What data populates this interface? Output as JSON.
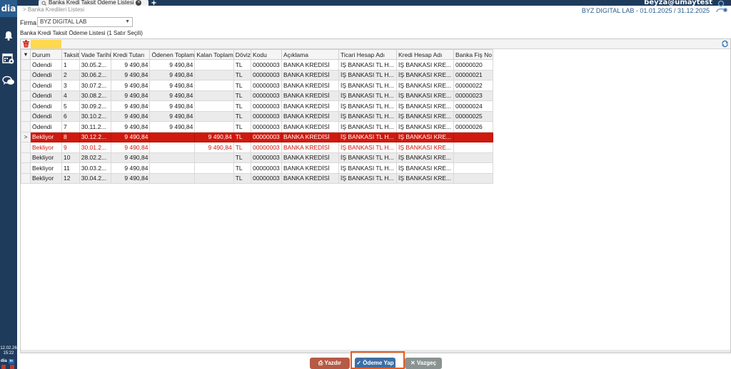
{
  "app": {
    "logo": "dia",
    "tab_title": "Banka Kredi Taksit Ödeme Listesi",
    "tab_close_icon": "close-icon",
    "tab_add": "+",
    "breadcrumb": "> Banka Kredileri Listesi",
    "user": "beyza@umaytest",
    "company_period": "BYZ DIGITAL LAB - 01.01.2025 / 31.12.2025"
  },
  "sidebar": {
    "icons": [
      "bell-icon",
      "calendar-gear-icon",
      "chat-icon"
    ],
    "date": "12.02.26",
    "time": "15:22",
    "brand": "dia",
    "social": "in"
  },
  "filter": {
    "firma_label": "Firma",
    "firma_value": "BYZ DIGITAL LAB"
  },
  "list": {
    "title": "Banka Kredi Taksit Ödeme Listesi  (1 Satır Seçili)"
  },
  "grid": {
    "columns": [
      "Durum",
      "Taksit",
      "Vade Tarihi",
      "Kredi Tutarı",
      "Ödenen Toplam",
      "Kalan Toplam",
      "Döviz",
      "Kodu",
      "Açıklama",
      "Ticari Hesap Adı",
      "Kredi Hesap Adı",
      "Banka Fiş No"
    ],
    "selected_indicator": ">",
    "rows": [
      {
        "durum": "Ödendi",
        "taksit": "1",
        "vade": "30.05.2...",
        "kredi": "9 490,84",
        "odenen": "9 490,84",
        "kalan": "",
        "doviz": "TL",
        "kodu": "00000003",
        "aciklama": "BANKA KREDİSİ",
        "ticari": "İŞ BANKASI TL H...",
        "kredi_hesap": "İŞ BANKASI KRE...",
        "fis": "00000020",
        "state": "paid"
      },
      {
        "durum": "Ödendi",
        "taksit": "2",
        "vade": "30.06.2...",
        "kredi": "9 490,84",
        "odenen": "9 490,84",
        "kalan": "",
        "doviz": "TL",
        "kodu": "00000003",
        "aciklama": "BANKA KREDİSİ",
        "ticari": "İŞ BANKASI TL H...",
        "kredi_hesap": "İŞ BANKASI KRE...",
        "fis": "00000021",
        "state": "paid"
      },
      {
        "durum": "Ödendi",
        "taksit": "3",
        "vade": "30.07.2...",
        "kredi": "9 490,84",
        "odenen": "9 490,84",
        "kalan": "",
        "doviz": "TL",
        "kodu": "00000003",
        "aciklama": "BANKA KREDİSİ",
        "ticari": "İŞ BANKASI TL H...",
        "kredi_hesap": "İŞ BANKASI KRE...",
        "fis": "00000022",
        "state": "paid"
      },
      {
        "durum": "Ödendi",
        "taksit": "4",
        "vade": "30.08.2...",
        "kredi": "9 490,84",
        "odenen": "9 490,84",
        "kalan": "",
        "doviz": "TL",
        "kodu": "00000003",
        "aciklama": "BANKA KREDİSİ",
        "ticari": "İŞ BANKASI TL H...",
        "kredi_hesap": "İŞ BANKASI KRE...",
        "fis": "00000023",
        "state": "paid"
      },
      {
        "durum": "Ödendi",
        "taksit": "5",
        "vade": "30.09.2...",
        "kredi": "9 490,84",
        "odenen": "9 490,84",
        "kalan": "",
        "doviz": "TL",
        "kodu": "00000003",
        "aciklama": "BANKA KREDİSİ",
        "ticari": "İŞ BANKASI TL H...",
        "kredi_hesap": "İŞ BANKASI KRE...",
        "fis": "00000024",
        "state": "paid"
      },
      {
        "durum": "Ödendi",
        "taksit": "6",
        "vade": "30.10.2...",
        "kredi": "9 490,84",
        "odenen": "9 490,84",
        "kalan": "",
        "doviz": "TL",
        "kodu": "00000003",
        "aciklama": "BANKA KREDİSİ",
        "ticari": "İŞ BANKASI TL H...",
        "kredi_hesap": "İŞ BANKASI KRE...",
        "fis": "00000025",
        "state": "paid"
      },
      {
        "durum": "Ödendi",
        "taksit": "7",
        "vade": "30.11.2...",
        "kredi": "9 490,84",
        "odenen": "9 490,84",
        "kalan": "",
        "doviz": "TL",
        "kodu": "00000003",
        "aciklama": "BANKA KREDİSİ",
        "ticari": "İŞ BANKASI TL H...",
        "kredi_hesap": "İŞ BANKASI KRE...",
        "fis": "00000026",
        "state": "paid"
      },
      {
        "durum": "Bekliyor",
        "taksit": "8",
        "vade": "30.12.2...",
        "kredi": "9 490,84",
        "odenen": "",
        "kalan": "9 490,84",
        "doviz": "TL",
        "kodu": "00000003",
        "aciklama": "BANKA KREDİSİ",
        "ticari": "İŞ BANKASI TL H...",
        "kredi_hesap": "İŞ BANKASI KRE...",
        "fis": "",
        "state": "selected"
      },
      {
        "durum": "Bekliyor",
        "taksit": "9",
        "vade": "30.01.2...",
        "kredi": "9 490,84",
        "odenen": "",
        "kalan": "9 490,84",
        "doviz": "TL",
        "kodu": "00000003",
        "aciklama": "BANKA KREDİSİ",
        "ticari": "İŞ BANKASI TL H...",
        "kredi_hesap": "İŞ BANKASI KRE...",
        "fis": "",
        "state": "pending-red"
      },
      {
        "durum": "Bekliyor",
        "taksit": "10",
        "vade": "28.02.2...",
        "kredi": "9 490,84",
        "odenen": "",
        "kalan": "",
        "doviz": "TL",
        "kodu": "00000003",
        "aciklama": "BANKA KREDİSİ",
        "ticari": "İŞ BANKASI TL H...",
        "kredi_hesap": "İŞ BANKASI KRE...",
        "fis": "",
        "state": "pending"
      },
      {
        "durum": "Bekliyor",
        "taksit": "11",
        "vade": "30.03.2...",
        "kredi": "9 490,84",
        "odenen": "",
        "kalan": "",
        "doviz": "TL",
        "kodu": "00000003",
        "aciklama": "BANKA KREDİSİ",
        "ticari": "İŞ BANKASI TL H...",
        "kredi_hesap": "İŞ BANKASI KRE...",
        "fis": "",
        "state": "pending"
      },
      {
        "durum": "Bekliyor",
        "taksit": "12",
        "vade": "30.04.2...",
        "kredi": "9 490,84",
        "odenen": "",
        "kalan": "",
        "doviz": "TL",
        "kodu": "00000003",
        "aciklama": "BANKA KREDİSİ",
        "ticari": "İŞ BANKASI TL H...",
        "kredi_hesap": "İŞ BANKASI KRE...",
        "fis": "",
        "state": "pending"
      }
    ]
  },
  "footer": {
    "print_label": "Yazdır",
    "pay_label": "Ödeme Yap",
    "cancel_label": "Vazgeç"
  },
  "colors": {
    "sidebar": "#1f3b5c",
    "selected_row": "#d0190e",
    "print_button": "#b65a45",
    "pay_button": "#3d6ea3",
    "cancel_button": "#8a9391",
    "focus_ring": "#ee5a16"
  }
}
